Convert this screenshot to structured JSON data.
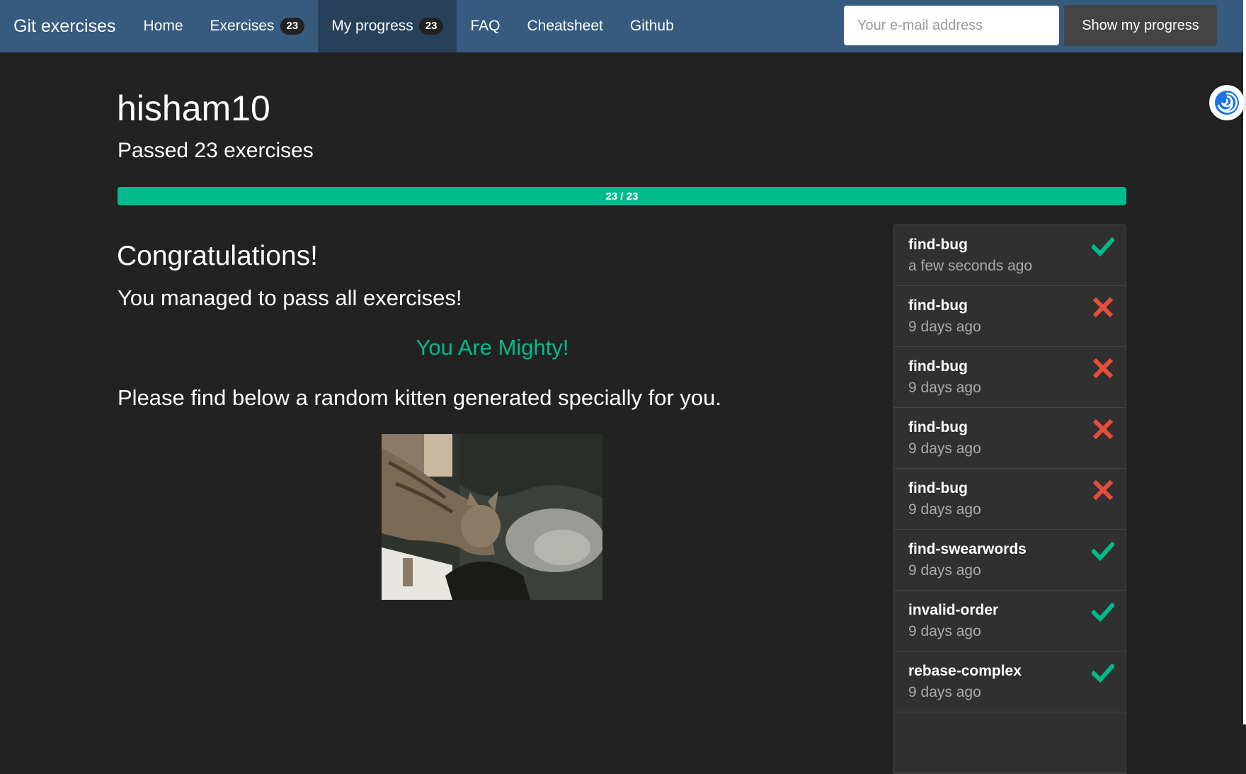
{
  "navbar": {
    "brand": "Git exercises",
    "links": [
      {
        "label": "Home"
      },
      {
        "label": "Exercises",
        "badge": "23"
      },
      {
        "label": "My progress",
        "badge": "23",
        "active": true
      },
      {
        "label": "FAQ"
      },
      {
        "label": "Cheatsheet"
      },
      {
        "label": "Github"
      }
    ],
    "email_placeholder": "Your e-mail address",
    "email_value": "",
    "show_button": "Show my progress"
  },
  "profile": {
    "username": "hisham10",
    "passed_text": "Passed 23 exercises",
    "progress": {
      "label": "23 / 23",
      "passed": 23,
      "total": 23
    }
  },
  "main": {
    "congrats_title": "Congratulations!",
    "managed_text": "You managed to pass all exercises!",
    "mighty_text": "You Are Mighty!",
    "kitten_text": "Please find below a random kitten generated specially for you."
  },
  "attempts": [
    {
      "name": "find-bug",
      "time": "a few seconds ago",
      "status": "passed"
    },
    {
      "name": "find-bug",
      "time": "9 days ago",
      "status": "failed"
    },
    {
      "name": "find-bug",
      "time": "9 days ago",
      "status": "failed"
    },
    {
      "name": "find-bug",
      "time": "9 days ago",
      "status": "failed"
    },
    {
      "name": "find-bug",
      "time": "9 days ago",
      "status": "failed"
    },
    {
      "name": "find-swearwords",
      "time": "9 days ago",
      "status": "passed"
    },
    {
      "name": "invalid-order",
      "time": "9 days ago",
      "status": "passed"
    },
    {
      "name": "rebase-complex",
      "time": "9 days ago",
      "status": "passed"
    }
  ],
  "colors": {
    "navbar": "#375a7f",
    "navbar_active": "#28415b",
    "background": "#222222",
    "success": "#00bc8c",
    "danger": "#e74c3c",
    "muted": "#aaaaaa"
  },
  "icons": {
    "passed": "checkmark-icon",
    "failed": "cross-icon",
    "extension": "swirl-icon"
  }
}
